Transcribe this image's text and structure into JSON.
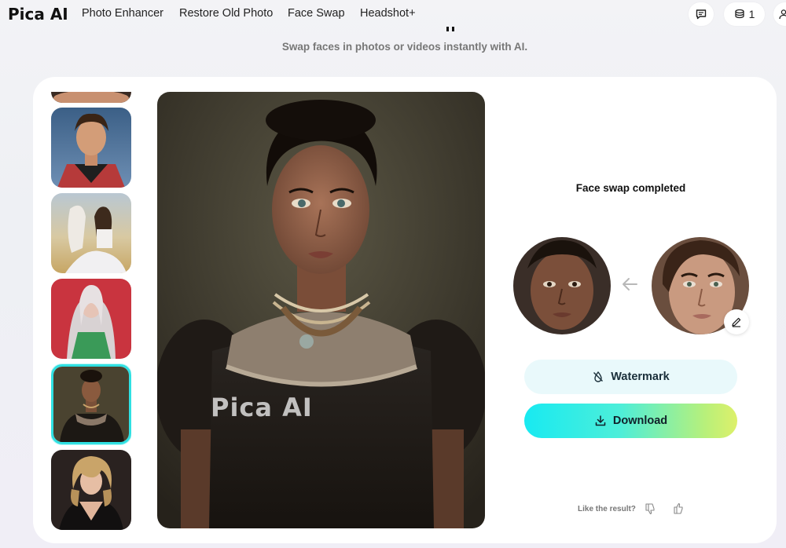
{
  "brand": {
    "name": "Pica AI"
  },
  "nav": {
    "links": [
      "Photo Enhancer",
      "Restore Old Photo",
      "Face Swap",
      "Headshot+"
    ],
    "credits": "1"
  },
  "header": {
    "subtitle": "Swap faces in photos or videos instantly with AI."
  },
  "result": {
    "status": "Face swap completed",
    "watermark_label": "Watermark",
    "download_label": "Download",
    "watermark_overlay": "Pica AI"
  },
  "feedback": {
    "prompt": "Like the result?"
  },
  "colors": {
    "accent_cyan": "#18eaf1",
    "accent_lime": "#ddf06a",
    "selected_border": "#2fe0e2"
  },
  "icons": [
    "chat-icon",
    "coins-icon",
    "user-icon",
    "arrow-left-icon",
    "pencil-icon",
    "no-watermark-icon",
    "download-icon",
    "thumbs-down-icon",
    "thumbs-up-icon"
  ]
}
